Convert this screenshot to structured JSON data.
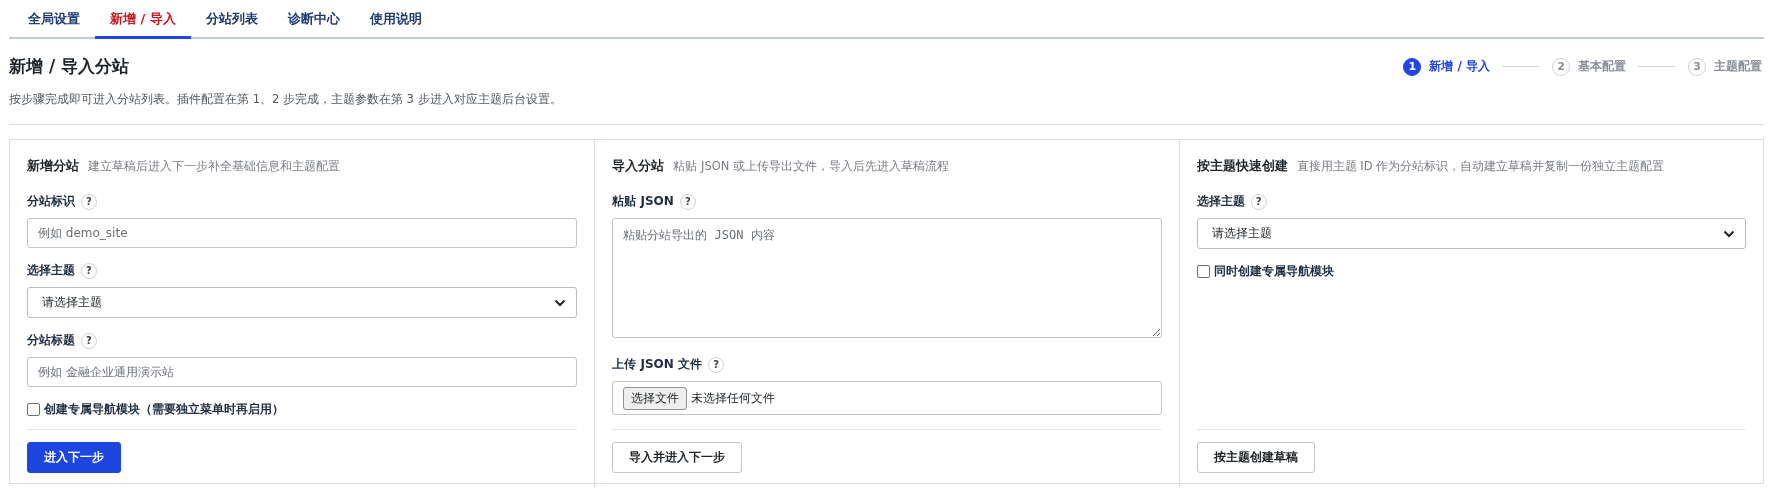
{
  "tabs": [
    {
      "label": "全局设置",
      "selected": false
    },
    {
      "label": "新增 / 导入",
      "selected": true
    },
    {
      "label": "分站列表",
      "selected": false
    },
    {
      "label": "诊断中心",
      "selected": false
    },
    {
      "label": "使用说明",
      "selected": false
    }
  ],
  "page": {
    "title": "新增 / 导入分站",
    "description": "按步骤完成即可进入分站列表。插件配置在第 1、2 步完成，主题参数在第 3 步进入对应主题后台设置。"
  },
  "steps": [
    {
      "number": "1",
      "label": "新增 / 导入",
      "selected": true
    },
    {
      "number": "2",
      "label": "基本配置",
      "selected": false
    },
    {
      "number": "3",
      "label": "主题配置",
      "selected": false
    }
  ],
  "panels": [
    {
      "title": "新增分站",
      "hint": "建立草稿后进入下一步补全基础信息和主题配置",
      "fields": [
        {
          "kind": "text",
          "label": "分站标识",
          "help": "?",
          "placeholder": "例如 demo_site"
        },
        {
          "kind": "select",
          "label": "选择主题",
          "help": "?",
          "value": "请选择主题"
        },
        {
          "kind": "text",
          "label": "分站标题",
          "help": "?",
          "placeholder": "例如 金融企业通用演示站"
        },
        {
          "kind": "checkbox",
          "label": "创建专属导航模块（需要独立菜单时再启用）",
          "checked": false
        }
      ],
      "button": {
        "label": "进入下一步",
        "primary": true
      }
    },
    {
      "title": "导入分站",
      "hint": "粘贴 JSON 或上传导出文件，导入后先进入草稿流程",
      "fields": [
        {
          "kind": "textarea",
          "label": "粘贴 JSON",
          "help": "?",
          "placeholder": "粘贴分站导出的 JSON 内容"
        },
        {
          "kind": "file",
          "label": "上传 JSON 文件",
          "help": "?",
          "button": "选择文件",
          "status": "未选择任何文件"
        }
      ],
      "button": {
        "label": "导入并进入下一步",
        "primary": false
      }
    },
    {
      "title": "按主题快速创建",
      "hint": "直接用主题 ID 作为分站标识，自动建立草稿并复制一份独立主题配置",
      "fields": [
        {
          "kind": "select",
          "label": "选择主题",
          "help": "?",
          "value": "请选择主题"
        },
        {
          "kind": "checkbox",
          "label": "同时创建专属导航模块",
          "checked": false
        }
      ],
      "button": {
        "label": "按主题创建草稿",
        "primary": false
      }
    }
  ]
}
